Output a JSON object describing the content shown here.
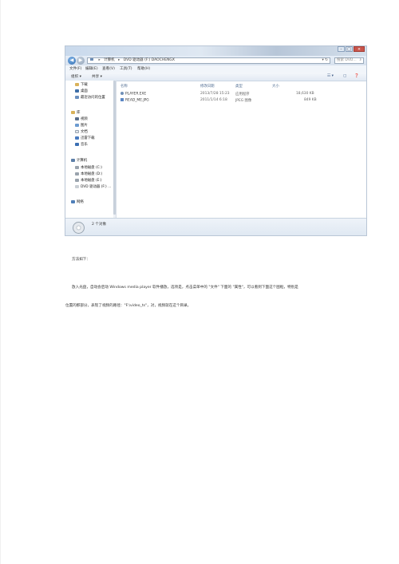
{
  "explorer": {
    "address": {
      "computer": "计算机",
      "drive": "DVD 驱动器 (F:) DAOCHENGX"
    },
    "search_placeholder": "搜索 DVD...",
    "menu": [
      "文件(F)",
      "编辑(E)",
      "查看(V)",
      "工具(T)",
      "帮助(H)"
    ],
    "toolbar": {
      "organize": "组织 ▾",
      "share": "共享 ▾"
    },
    "nav": {
      "favorites": [
        {
          "label": "下载",
          "icon": "download-folder-icon"
        },
        {
          "label": "桌面",
          "icon": "desktop-icon"
        },
        {
          "label": "最近访问的位置",
          "icon": "recent-places-icon"
        }
      ],
      "libraries_label": "库",
      "libraries": [
        {
          "label": "视频",
          "icon": "video-library-icon"
        },
        {
          "label": "图片",
          "icon": "pictures-library-icon"
        },
        {
          "label": "文档",
          "icon": "documents-library-icon"
        },
        {
          "label": "迅雷下载",
          "icon": "thunder-download-icon"
        },
        {
          "label": "音乐",
          "icon": "music-library-icon"
        }
      ],
      "computer_label": "计算机",
      "drives": [
        {
          "label": "本地磁盘 (C:)",
          "icon": "local-disk-icon"
        },
        {
          "label": "本地磁盘 (D:)",
          "icon": "local-disk-icon"
        },
        {
          "label": "本地磁盘 (E:)",
          "icon": "local-disk-icon"
        },
        {
          "label": "DVD 驱动器 (F:) ...",
          "icon": "dvd-drive-icon"
        }
      ],
      "network_label": "网络"
    },
    "columns": [
      "名称",
      "修改日期",
      "类型",
      "大小"
    ],
    "files": [
      {
        "name": "PLAYER.EXE",
        "date": "2013/7/28 15:23",
        "type": "应用程序",
        "size": "18,630 KB",
        "icon": "exe-file-icon"
      },
      {
        "name": "READ_ME.JPG",
        "date": "2011/1/14 6:18",
        "type": "JPEG 图像",
        "size": "849 KB",
        "icon": "jpg-file-icon"
      }
    ],
    "status": "2 个对象"
  },
  "document": {
    "heading": "方法如下：",
    "paragraph_line1": "放入光盘，自动会启动 Windows media player 软件播放，选项是，点击菜单中的 \"文件\" 下面的 \"属性\"，可以看到下面这个图框，特别是",
    "paragraph_line2": "位置的那部分，表现了视频的路径：\"F:\\video_ts\"，对，视频就在这个目录。"
  },
  "colors": {
    "titlebar": "#c9d9ec",
    "link": "#4e6b91",
    "close_button": "#c9544a"
  }
}
